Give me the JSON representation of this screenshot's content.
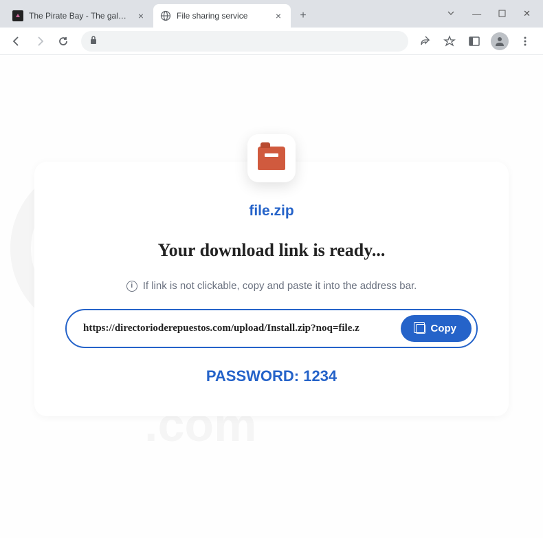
{
  "window": {
    "tabs": [
      {
        "title": "The Pirate Bay - The galaxy's mos…",
        "active": false,
        "favicon": "dark"
      },
      {
        "title": "File sharing service",
        "active": true,
        "favicon": "globe"
      }
    ]
  },
  "content": {
    "filename": "file.zip",
    "headline": "Your download link is ready...",
    "instruction": "If link is not clickable, copy and paste it into the address bar.",
    "url": "https://directorioderepuestos.com/upload/Install.zip?noq=file.z",
    "copy_label": "Copy",
    "password_label": "PASSWORD: 1234"
  },
  "watermark": "pcrisk.com"
}
